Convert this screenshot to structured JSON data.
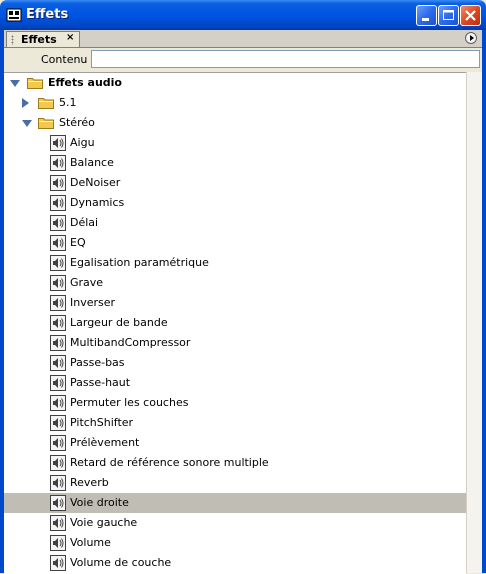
{
  "window": {
    "title": "Effets"
  },
  "panel": {
    "tab_label": "Effets",
    "tab_close": "×"
  },
  "search": {
    "label": "Contenu :",
    "value": "",
    "placeholder": ""
  },
  "tree": {
    "root": {
      "label": "Effets audio",
      "expanded": true
    },
    "folders": [
      {
        "label": "5.1",
        "expanded": false
      },
      {
        "label": "Stéréo",
        "expanded": true
      }
    ],
    "stereo_items": [
      "Aigu",
      "Balance",
      "DeNoiser",
      "Dynamics",
      "Délai",
      "EQ",
      "Egalisation paramétrique",
      "Grave",
      "Inverser",
      "Largeur de bande",
      "MultibandCompressor",
      "Passe-bas",
      "Passe-haut",
      "Permuter les couches",
      "PitchShifter",
      "Prélèvement",
      "Retard de référence sonore multiple",
      "Reverb",
      "Voie droite",
      "Voie gauche",
      "Volume",
      "Volume de couche"
    ],
    "selected_item": "Voie droite"
  },
  "colors": {
    "titlebar": "#0054e3",
    "selection": "#c0bdb5",
    "folder": "#f2c94c",
    "twisty": "#4a6fa5"
  },
  "icons": {
    "app": "effects-app-icon",
    "folder": "folder-icon",
    "effect": "audio-effect-icon",
    "minimize": "minimize-icon",
    "maximize": "maximize-icon",
    "close": "close-icon"
  }
}
